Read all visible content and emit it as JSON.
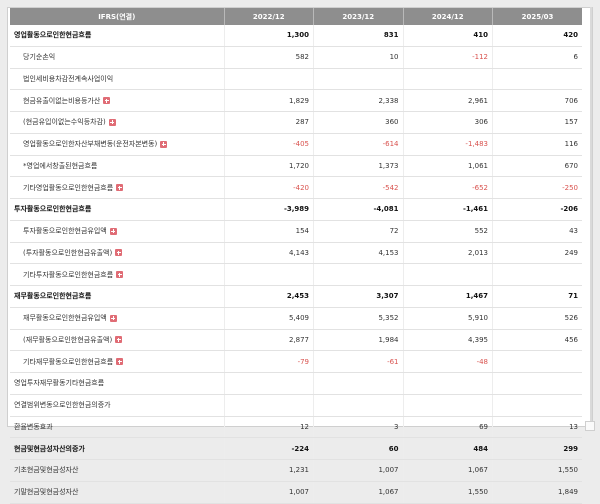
{
  "header": {
    "first_col": "IFRS(연결)",
    "periods": [
      "2022/12",
      "2023/12",
      "2024/12",
      "2025/03"
    ]
  },
  "rows": [
    {
      "label": "영업활동으로인한현금흐름",
      "major": true,
      "sub": false,
      "expand": false,
      "values": [
        "1,300",
        "831",
        "410",
        "420"
      ],
      "neg": [
        false,
        false,
        false,
        false
      ]
    },
    {
      "label": "당기순손익",
      "major": false,
      "sub": true,
      "expand": false,
      "values": [
        "582",
        "10",
        "-112",
        "6"
      ],
      "neg": [
        false,
        false,
        true,
        false
      ]
    },
    {
      "label": "법인세비용차감전계속사업이익",
      "major": false,
      "sub": true,
      "expand": false,
      "values": [
        "",
        "",
        "",
        ""
      ],
      "neg": [
        false,
        false,
        false,
        false
      ]
    },
    {
      "label": "현금유출이없는비용등가산",
      "major": false,
      "sub": true,
      "expand": true,
      "values": [
        "1,829",
        "2,338",
        "2,961",
        "706"
      ],
      "neg": [
        false,
        false,
        false,
        false
      ]
    },
    {
      "label": "(현금유입이없는수익등차감)",
      "major": false,
      "sub": true,
      "expand": true,
      "values": [
        "287",
        "360",
        "306",
        "157"
      ],
      "neg": [
        false,
        false,
        false,
        false
      ]
    },
    {
      "label": "영업활동으로인한자산부채변동(운전자본변동)",
      "major": false,
      "sub": true,
      "expand": true,
      "values": [
        "-405",
        "-614",
        "-1,483",
        "116"
      ],
      "neg": [
        true,
        true,
        true,
        false
      ]
    },
    {
      "label": "*영업에서창출된현금흐름",
      "major": false,
      "sub": true,
      "expand": false,
      "values": [
        "1,720",
        "1,373",
        "1,061",
        "670"
      ],
      "neg": [
        false,
        false,
        false,
        false
      ]
    },
    {
      "label": "기타영업활동으로인한현금흐름",
      "major": false,
      "sub": true,
      "expand": true,
      "values": [
        "-420",
        "-542",
        "-652",
        "-250"
      ],
      "neg": [
        true,
        true,
        true,
        true
      ]
    },
    {
      "label": "투자활동으로인한현금흐름",
      "major": true,
      "sub": false,
      "expand": false,
      "values": [
        "-3,989",
        "-4,081",
        "-1,461",
        "-206"
      ],
      "neg": [
        true,
        true,
        true,
        true
      ]
    },
    {
      "label": "투자활동으로인한현금유입액",
      "major": false,
      "sub": true,
      "expand": true,
      "values": [
        "154",
        "72",
        "552",
        "43"
      ],
      "neg": [
        false,
        false,
        false,
        false
      ]
    },
    {
      "label": "(투자활동으로인한현금유출액)",
      "major": false,
      "sub": true,
      "expand": true,
      "values": [
        "4,143",
        "4,153",
        "2,013",
        "249"
      ],
      "neg": [
        false,
        false,
        false,
        false
      ]
    },
    {
      "label": "기타투자활동으로인한현금흐름",
      "major": false,
      "sub": true,
      "expand": true,
      "values": [
        "",
        "",
        "",
        ""
      ],
      "neg": [
        false,
        false,
        false,
        false
      ]
    },
    {
      "label": "재무활동으로인한현금흐름",
      "major": true,
      "sub": false,
      "expand": false,
      "values": [
        "2,453",
        "3,307",
        "1,467",
        "71"
      ],
      "neg": [
        false,
        false,
        false,
        false
      ]
    },
    {
      "label": "재무활동으로인한현금유입액",
      "major": false,
      "sub": true,
      "expand": true,
      "values": [
        "5,409",
        "5,352",
        "5,910",
        "526"
      ],
      "neg": [
        false,
        false,
        false,
        false
      ]
    },
    {
      "label": "(재무활동으로인한현금유출액)",
      "major": false,
      "sub": true,
      "expand": true,
      "values": [
        "2,877",
        "1,984",
        "4,395",
        "456"
      ],
      "neg": [
        false,
        false,
        false,
        false
      ]
    },
    {
      "label": "기타재무활동으로인한현금흐름",
      "major": false,
      "sub": true,
      "expand": true,
      "values": [
        "-79",
        "-61",
        "-48",
        ""
      ],
      "neg": [
        true,
        true,
        true,
        false
      ]
    },
    {
      "label": "영업투자재무활동기타현금흐름",
      "major": false,
      "sub": false,
      "expand": false,
      "values": [
        "",
        "",
        "",
        ""
      ],
      "neg": [
        false,
        false,
        false,
        false
      ]
    },
    {
      "label": "연결범위변동으로인한현금의증가",
      "major": false,
      "sub": false,
      "expand": false,
      "values": [
        "",
        "",
        "",
        ""
      ],
      "neg": [
        false,
        false,
        false,
        false
      ]
    },
    {
      "label": "환율변동효과",
      "major": false,
      "sub": false,
      "expand": false,
      "values": [
        "12",
        "3",
        "69",
        "13"
      ],
      "neg": [
        false,
        false,
        false,
        false
      ]
    },
    {
      "label": "현금및현금성자산의증가",
      "major": true,
      "sub": false,
      "expand": false,
      "values": [
        "-224",
        "60",
        "484",
        "299"
      ],
      "neg": [
        true,
        false,
        false,
        false
      ]
    },
    {
      "label": "기초현금및현금성자산",
      "major": false,
      "sub": false,
      "expand": false,
      "values": [
        "1,231",
        "1,007",
        "1,067",
        "1,550"
      ],
      "neg": [
        false,
        false,
        false,
        false
      ]
    },
    {
      "label": "기말현금및현금성자산",
      "major": false,
      "sub": false,
      "expand": false,
      "values": [
        "1,007",
        "1,067",
        "1,550",
        "1,849"
      ],
      "neg": [
        false,
        false,
        false,
        false
      ]
    }
  ],
  "icons": {
    "expand": "plus-square-icon",
    "expand_color": "#e06c75",
    "negative_color": "#d9534f",
    "header_bg": "#8e8e8e"
  }
}
